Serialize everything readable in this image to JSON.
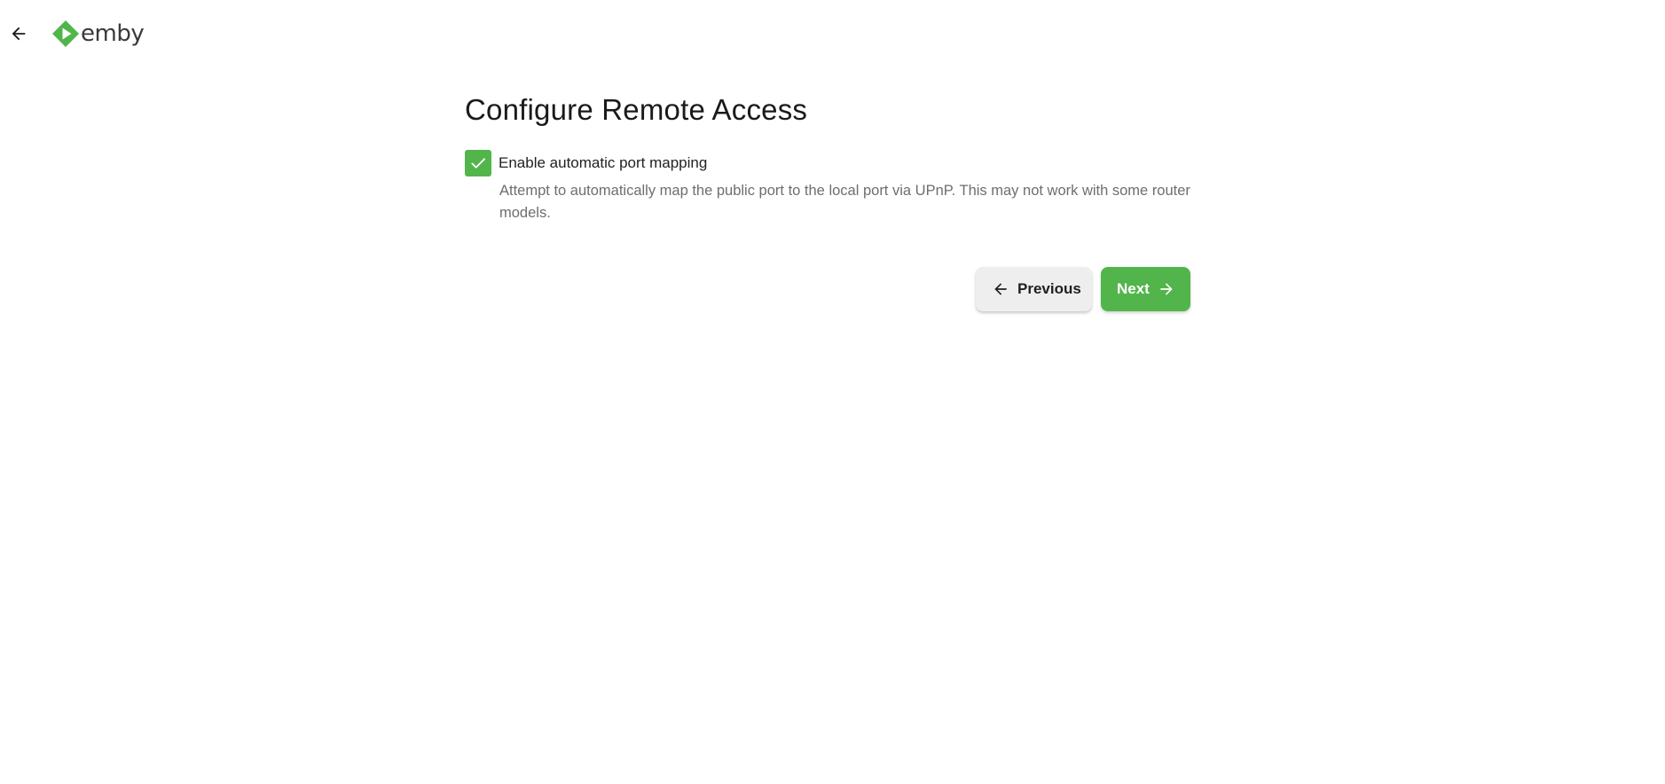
{
  "header": {
    "back_icon": "arrow-left-icon",
    "logo_text": "emby",
    "brand_color": "#52b54b"
  },
  "page": {
    "title": "Configure Remote Access"
  },
  "port_mapping": {
    "checked": true,
    "label": "Enable automatic port mapping",
    "description": "Attempt to automatically map the public port to the local port via UPnP. This may not work with some router models."
  },
  "buttons": {
    "previous_label": "Previous",
    "previous_icon": "arrow-left-icon",
    "next_label": "Next",
    "next_icon": "arrow-right-icon"
  }
}
